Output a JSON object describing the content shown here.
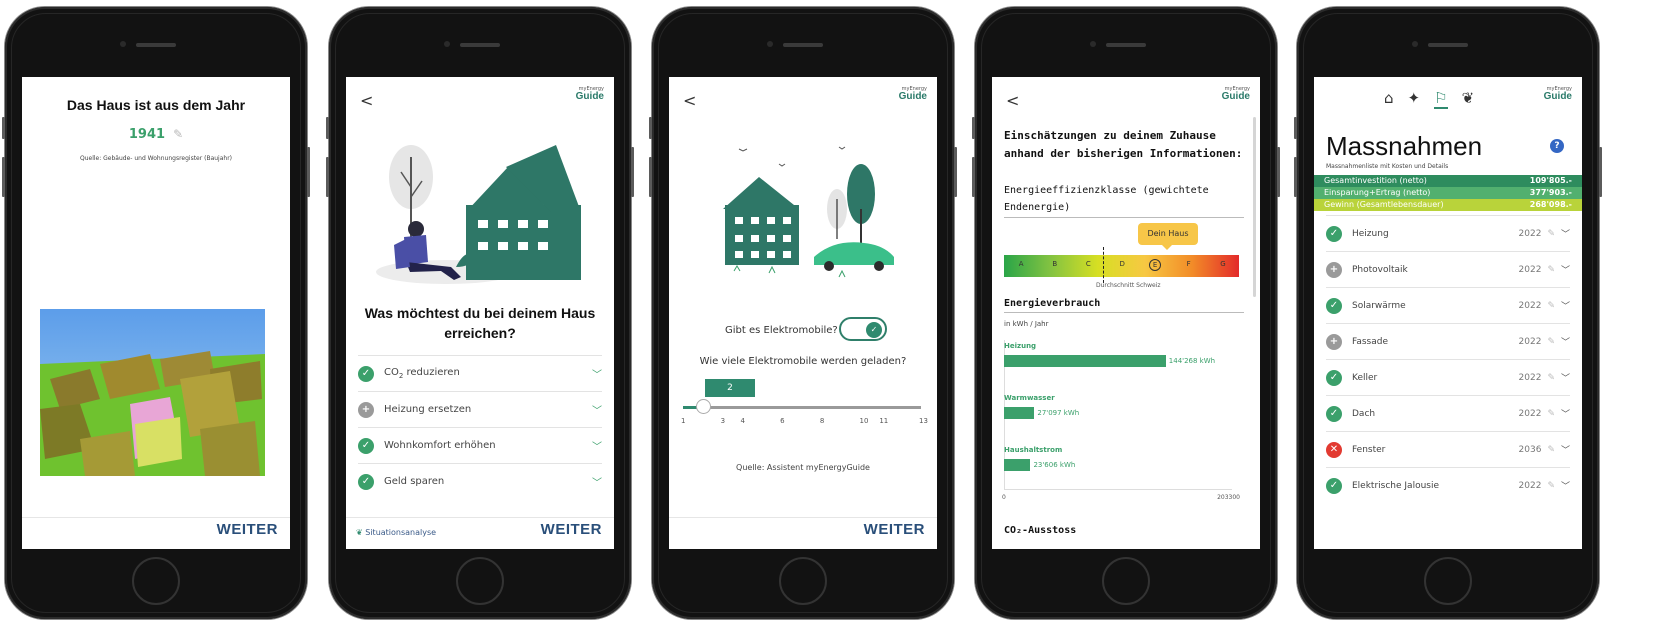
{
  "common": {
    "weiter": "WEITER",
    "back": "<",
    "logo_small": "myEnergy",
    "logo_big": "Guide"
  },
  "screen1": {
    "title": "Das Haus ist aus dem Jahr",
    "year": "1941",
    "source": "Quelle: Gebäude- und Wohnungsregister (Baujahr)"
  },
  "screen2": {
    "question": "Was möchtest du bei deinem Haus erreichen?",
    "options": [
      {
        "label_pre": "CO",
        "label_sub": "2",
        "label_post": " reduzieren",
        "state": "checked"
      },
      {
        "label": "Heizung ersetzen",
        "state": "add"
      },
      {
        "label": "Wohnkomfort erhöhen",
        "state": "checked"
      },
      {
        "label": "Geld sparen",
        "state": "checked"
      }
    ],
    "footer_link": "Situationsanalyse"
  },
  "screen3": {
    "question_ev": "Gibt es Elektromobile?",
    "question_count": "Wie viele Elektromobile werden geladen?",
    "slider_value": "2",
    "slider_min": 1,
    "slider_max": 13,
    "ticks": [
      "1",
      "3",
      "4",
      "6",
      "8",
      "10",
      "11",
      "13"
    ],
    "source": "Quelle: Assistent myEnergyGuide"
  },
  "screen4": {
    "heading": "Einschätzungen zu deinem Zuhause anhand der bisherigen Informationen:",
    "efficiency_label": "Energieeffizienzklasse (gewichtete Endenergie)",
    "classes": [
      "A",
      "B",
      "C",
      "D",
      "E",
      "F",
      "G"
    ],
    "your_house_class": "E",
    "your_house_label": "Dein Haus",
    "average_label": "Durchschnitt Schweiz",
    "average_class": "D",
    "consumption_title": "Energieverbrauch",
    "unit": "in kWh / Jahr",
    "chart_data": {
      "type": "bar",
      "categories": [
        "Heizung",
        "Warmwasser",
        "Haushaltstrom"
      ],
      "values": [
        144268,
        27097,
        23606
      ],
      "value_labels": [
        "144'268 kWh",
        "27'097 kWh",
        "23'606 kWh"
      ],
      "xlim": [
        0,
        203300
      ],
      "xlim_labels": [
        "0",
        "203300"
      ]
    },
    "next_section": "CO₂-Ausstoss"
  },
  "screen5": {
    "title": "Massnahmen",
    "subtitle": "Massnahmenliste mit Kosten und Details",
    "summary": [
      {
        "label": "Gesamtinvestition (netto)",
        "value": "109'805.-",
        "color": "#2e8c5e"
      },
      {
        "label": "Einsparung+Ertrag (netto)",
        "value": "377'903.-",
        "color": "#52b06f"
      },
      {
        "label": "Gewinn (Gesamtlebensdauer)",
        "value": "268'098.-",
        "color": "#b9d33a"
      }
    ],
    "measures": [
      {
        "label": "Heizung",
        "year": "2022",
        "state": "checked"
      },
      {
        "label": "Photovoltaik",
        "year": "2022",
        "state": "add"
      },
      {
        "label": "Solarwärme",
        "year": "2022",
        "state": "checked"
      },
      {
        "label": "Fassade",
        "year": "2022",
        "state": "add"
      },
      {
        "label": "Keller",
        "year": "2022",
        "state": "checked"
      },
      {
        "label": "Dach",
        "year": "2022",
        "state": "checked"
      },
      {
        "label": "Fenster",
        "year": "2036",
        "state": "rejected"
      },
      {
        "label": "Elektrische Jalousie",
        "year": "2022",
        "state": "checked"
      }
    ]
  }
}
